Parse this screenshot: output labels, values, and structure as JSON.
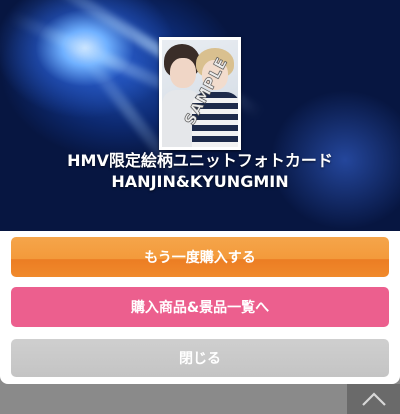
{
  "modal": {
    "product_title": "HMV限定絵柄ユニットフォトカード HANJIN&KYUNGMIN",
    "image_watermark": "SAMPLE"
  },
  "buttons": {
    "buy_again_label": "もう一度購入する",
    "product_list_label": "購入商品&景品一覧へ",
    "close_label": "閉じる"
  },
  "icons": {
    "page_top": "chevron-up-icon"
  },
  "colors": {
    "buy_again": "#f39a3b",
    "product_list": "#ec5f8e",
    "close": "#c9c9c9",
    "backdrop": "#8a8a8a"
  }
}
